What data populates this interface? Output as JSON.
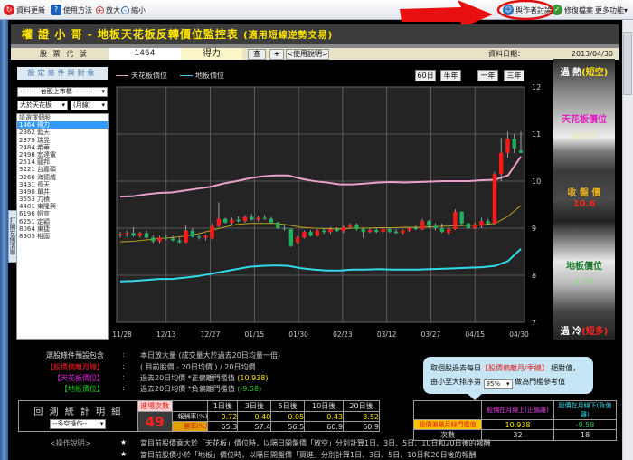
{
  "toolbar": {
    "refresh": "資料更新",
    "howto": "使用方法",
    "zoom_in": "放大",
    "zoom_out": "縮小",
    "discuss": "與作者討論",
    "repair": "修復檔案",
    "more": "更多功能▾"
  },
  "title": {
    "main": "權 證 小 哥 -  地板天花板反轉價位監控表",
    "sub": "(適用短線逆勢交易)"
  },
  "info": {
    "code_label": "股 票 代 號",
    "code": "1464",
    "name": "得力",
    "query": "查",
    "plus": "+",
    "help": "<使用說明>",
    "date_label": "資料日期：",
    "date": "2013/04/30"
  },
  "left": {
    "setup": "設定條件與對象",
    "market": "---------台股上市櫃---------",
    "cond": "大於天花板",
    "period": "(月線)",
    "list": [
      "請選擇個股",
      "1464  得力",
      "2362  藍天",
      "2379  瑞昱",
      "2484  希華",
      "2498  宏達電",
      "2514  龍邦",
      "3221  台嘉碩",
      "3268  海德威",
      "3431  長天",
      "3490  單井",
      "3553  力積",
      "4401  東隆興",
      "6196  帆宣",
      "6251  定穎",
      "8064  東捷",
      "8905  裕國"
    ],
    "selected_index": 1,
    "side_tab": "打開左側清單"
  },
  "ranges": [
    "60日",
    "半年",
    "一年",
    "三年"
  ],
  "right_panel": {
    "hot": "過 熱",
    "hot_tag": "(短空)",
    "ceiling_label": "天花板價位",
    "ceiling": "10.52",
    "close_label": "收 盤 價",
    "close": "10.6",
    "floor_label": "地板價位",
    "floor": "8.58",
    "cold": "過 冷",
    "cold_tag": "(短多)"
  },
  "colors": {
    "ceiling": "#e8a0c8",
    "floor": "#30d8e8",
    "ma": "#b8a020",
    "up": "#ff1a1a",
    "down": "#20b060"
  },
  "chart_data": {
    "type": "candlestick",
    "legend": [
      "天花板價位",
      "地板價位"
    ],
    "x_ticks": [
      "11/28",
      "12/13",
      "12/27",
      "01/15",
      "01/30",
      "02/23",
      "03/12",
      "03/27",
      "04/15",
      "04/30"
    ],
    "ylim": [
      7,
      12
    ],
    "y_ticks": [
      12,
      11,
      10,
      9,
      8,
      7
    ],
    "ceiling": [
      9.67,
      9.68,
      9.72,
      9.75,
      9.76,
      9.8,
      9.84,
      9.88,
      9.95,
      10.0,
      10.06,
      10.1,
      10.12,
      10.12,
      10.05,
      10.0,
      9.97,
      9.93,
      9.93,
      9.95,
      9.97,
      9.98,
      9.97,
      9.98,
      9.99,
      10.0,
      10.0,
      10.0,
      10.02,
      10.03,
      10.12,
      10.52
    ],
    "floor": [
      7.87,
      7.88,
      7.9,
      7.92,
      7.92,
      7.95,
      7.98,
      8.03,
      8.08,
      8.13,
      8.18,
      8.2,
      8.21,
      8.2,
      8.15,
      8.12,
      8.1,
      8.1,
      8.12,
      8.12,
      8.13,
      8.12,
      8.12,
      8.12,
      8.13,
      8.14,
      8.15,
      8.16,
      8.17,
      8.2,
      8.3,
      8.56
    ],
    "ma20": [
      8.71,
      8.72,
      8.75,
      8.78,
      8.8,
      8.83,
      8.88,
      8.95,
      9.02,
      9.08,
      9.1,
      9.1,
      9.1,
      9.07,
      9.02,
      9.0,
      8.99,
      8.98,
      9.0,
      9.0,
      9.01,
      9.01,
      9.02,
      9.02,
      9.03,
      9.04,
      9.05,
      9.06,
      9.07,
      9.1,
      9.25,
      9.48
    ],
    "candles": [
      [
        8.85,
        8.92,
        8.8,
        8.88
      ],
      [
        8.88,
        8.95,
        8.82,
        8.9
      ],
      [
        8.9,
        9.02,
        8.82,
        8.84
      ],
      [
        8.84,
        8.92,
        8.8,
        8.9
      ],
      [
        8.9,
        8.95,
        8.78,
        8.8
      ],
      [
        8.8,
        8.85,
        8.68,
        8.72
      ],
      [
        8.72,
        8.84,
        8.68,
        8.8
      ],
      [
        8.8,
        8.86,
        8.74,
        8.78
      ],
      [
        8.78,
        8.84,
        8.72,
        8.74
      ],
      [
        8.74,
        8.8,
        8.68,
        8.7
      ],
      [
        8.7,
        9.06,
        8.68,
        8.95
      ],
      [
        8.95,
        9.0,
        8.8,
        8.82
      ],
      [
        8.82,
        8.86,
        8.76,
        8.8
      ],
      [
        8.8,
        8.86,
        8.74,
        8.84
      ],
      [
        8.78,
        9.1,
        8.76,
        9.05
      ],
      [
        9.05,
        9.55,
        9.02,
        9.2
      ],
      [
        9.2,
        9.22,
        9.1,
        9.12
      ],
      [
        9.12,
        9.22,
        9.08,
        9.18
      ],
      [
        9.18,
        9.25,
        9.12,
        9.15
      ],
      [
        9.15,
        9.28,
        9.12,
        9.24
      ],
      [
        9.24,
        9.3,
        9.16,
        9.18
      ],
      [
        9.18,
        9.26,
        9.14,
        9.22
      ],
      [
        9.22,
        9.28,
        9.18,
        9.2
      ],
      [
        9.2,
        9.24,
        9.1,
        9.12
      ],
      [
        9.12,
        9.14,
        8.98,
        9.0
      ],
      [
        9.0,
        9.06,
        8.95,
        8.98
      ],
      [
        8.98,
        9.0,
        8.6,
        8.62
      ],
      [
        8.7,
        8.84,
        8.66,
        8.8
      ],
      [
        8.8,
        8.95,
        8.78,
        8.92
      ],
      [
        8.92,
        8.96,
        8.82,
        8.84
      ],
      [
        8.84,
        8.98,
        8.82,
        8.95
      ],
      [
        8.95,
        9.0,
        8.88,
        8.92
      ],
      [
        8.92,
        9.02,
        8.88,
        8.98
      ],
      [
        8.98,
        9.02,
        8.92,
        8.94
      ],
      [
        8.94,
        9.05,
        8.9,
        9.02
      ],
      [
        9.02,
        9.1,
        9.0,
        9.08
      ],
      [
        9.08,
        9.1,
        8.95,
        8.98
      ],
      [
        8.98,
        9.02,
        8.8,
        8.92
      ],
      [
        8.92,
        9.0,
        8.9,
        8.96
      ],
      [
        8.96,
        9.0,
        8.9,
        8.92
      ],
      [
        8.92,
        9.02,
        8.88,
        8.98
      ],
      [
        8.98,
        9.0,
        8.9,
        8.93
      ],
      [
        8.93,
        8.98,
        8.88,
        8.9
      ],
      [
        8.9,
        8.98,
        8.86,
        8.95
      ],
      [
        8.95,
        9.02,
        8.92,
        9.0
      ],
      [
        9.0,
        9.05,
        8.96,
        8.98
      ],
      [
        8.98,
        9.2,
        8.96,
        9.15
      ],
      [
        9.15,
        9.18,
        9.0,
        9.05
      ],
      [
        9.05,
        9.1,
        8.95,
        9.0
      ],
      [
        9.0,
        9.1,
        8.9,
        8.92
      ],
      [
        8.9,
        9.02,
        8.85,
        8.98
      ],
      [
        8.98,
        9.4,
        8.96,
        9.35
      ],
      [
        9.35,
        9.36,
        9.05,
        9.1
      ],
      [
        9.1,
        9.12,
        8.98,
        9.0
      ],
      [
        9.0,
        9.12,
        8.98,
        9.08
      ],
      [
        9.05,
        9.22,
        9.0,
        9.15
      ],
      [
        9.15,
        9.2,
        9.08,
        9.1
      ],
      [
        9.1,
        10.2,
        9.08,
        10.15
      ],
      [
        10.15,
        10.92,
        10.0,
        10.6
      ],
      [
        10.6,
        11.05,
        10.5,
        10.9
      ],
      [
        10.9,
        11.0,
        10.6,
        10.7
      ],
      [
        10.65,
        11.05,
        10.6,
        10.6
      ]
    ]
  },
  "bottom": {
    "rows": [
      {
        "label": "選股條件預設包含",
        "text": "本日放大量 (成交量大於過去20日均量一倍)"
      },
      {
        "label": "【股價偏離月線】",
        "text": "( 目前股價 - 20日均價 ) /  20日均價"
      },
      {
        "label": "【天花板價位】",
        "text": "過去20日均價 *正偏離門檻值",
        "value": "(10.938)"
      },
      {
        "label": "【地板價位】",
        "text": "過去20日均價 *負偏離門檻值",
        "value": "(-9.58)"
      }
    ],
    "colon": ":",
    "backtest_title": "回 測 統 計 明 細",
    "backtest_select": "--多空操作--",
    "entries_label": "進場次數",
    "entries": "49",
    "periods": [
      "1日後",
      "3日後",
      "5日後",
      "10日後",
      "20日後"
    ],
    "return_label": "報酬率(%)",
    "returns": [
      "0.72",
      "0.40",
      "0.05",
      "0.43",
      "3.52"
    ],
    "win_label": "勝率(%)",
    "wins": [
      "65.3",
      "57.4",
      "56.5",
      "60.9",
      "60.9"
    ],
    "notes_label": "<操作說明>",
    "star": "★",
    "notes": [
      "當目前股價乘大於「天花板」價位時，以隔日開盤價「放空」分別計算1日、3日、5日、10日和20日後的報酬",
      "當目前股價小於「地板」價位時，以隔日開盤價「買進」分別計算1日、3日、5日、10日和20日後的報酬"
    ]
  },
  "bubble": {
    "line1a": "取個股過去每日",
    "line1b": "【股價偏離月/季線】",
    "line1c": "絕對值，",
    "line2a": "由小至大排序第",
    "pct": "95%",
    "line2b": "做為門檻參考值"
  },
  "threshold": {
    "col_pos": "股價在月線上(正偏離)",
    "col_neg": "股價在月線下(負偏離)",
    "row1": "股價偏離月線門檻值",
    "pos": "10.938",
    "neg": "-9.58",
    "row2": "次數",
    "pos_n": "32",
    "neg_n": "18"
  }
}
